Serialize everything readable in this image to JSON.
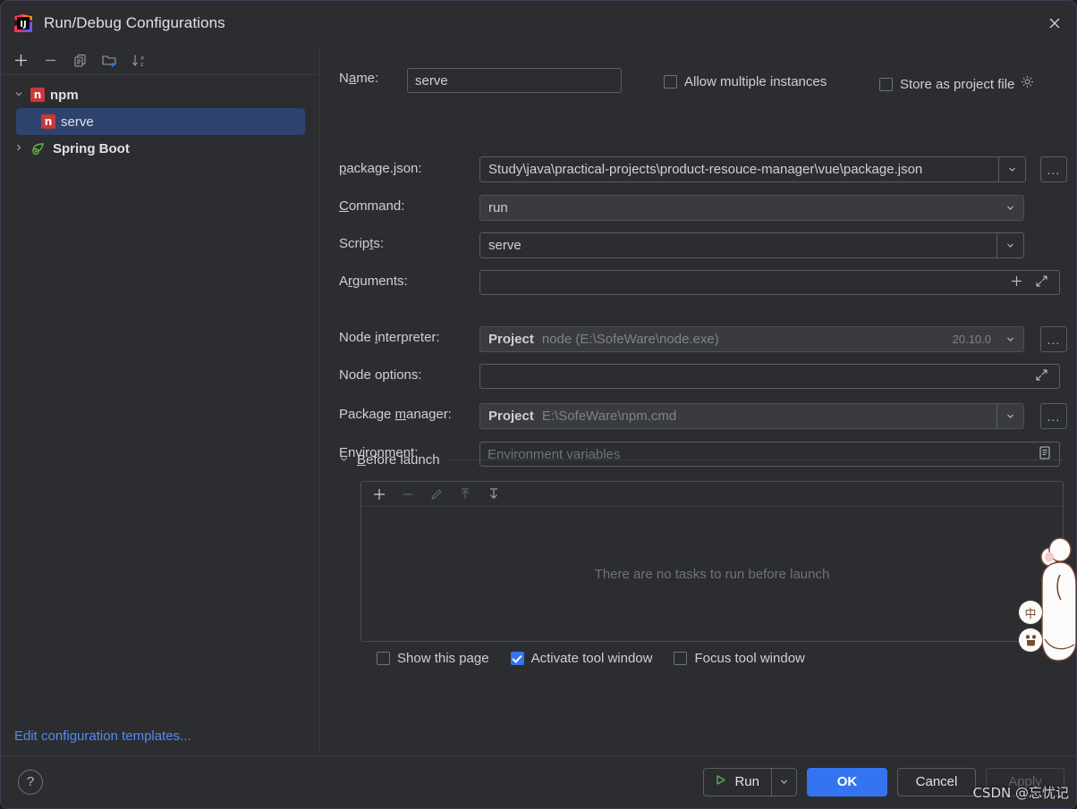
{
  "window": {
    "title": "Run/Debug Configurations",
    "app_icon": "intellij-idea-icon",
    "close_label": "✕"
  },
  "left_panel": {
    "toolbar": [
      {
        "name": "add-configuration-button",
        "label": "+"
      },
      {
        "name": "remove-configuration-button",
        "label": "−"
      },
      {
        "name": "copy-configuration-button",
        "label": "copy-icon"
      },
      {
        "name": "new-folder-button",
        "label": "new-folder-icon"
      },
      {
        "name": "sort-configurations-button",
        "label": "sort-az-icon"
      }
    ],
    "tree": [
      {
        "label": "npm",
        "icon": "npm-icon",
        "expanded": true,
        "level": 0,
        "selected": false,
        "caret": "⌄"
      },
      {
        "label": "serve",
        "icon": "npm-icon",
        "level": 1,
        "selected": true,
        "caret": ""
      },
      {
        "label": "Spring Boot",
        "icon": "spring-boot-icon",
        "expanded": false,
        "level": 0,
        "selected": false,
        "caret": "›"
      }
    ],
    "edit_templates_link": "Edit configuration templates..."
  },
  "form": {
    "name": {
      "label_pre": "N",
      "label_mnemonic": "a",
      "label_post": "me:",
      "label_full": "Name:",
      "value": "serve"
    },
    "allow_multiple_instances": {
      "label": "Allow multiple instances",
      "checked": false
    },
    "store_as_project_file": {
      "label": "Store as project file",
      "checked": false,
      "icon": "gear-icon"
    },
    "package_json": {
      "label_pre": "",
      "label_mnemonic": "p",
      "label_post": "ackage.json:",
      "label_full": "package.json:",
      "value": "Study\\java\\practical-projects\\product-resouce-manager\\vue\\package.json",
      "dropdown_icon": "chevron-down-icon",
      "browse_label": "..."
    },
    "command": {
      "label_pre": "",
      "label_mnemonic": "C",
      "label_post": "ommand:",
      "label_full": "Command:",
      "value": "run",
      "dropdown_icon": "chevron-down-icon"
    },
    "scripts": {
      "label_pre": "Scrip",
      "label_mnemonic": "t",
      "label_post": "s:",
      "label_full": "Scripts:",
      "value": "serve",
      "dropdown_icon": "chevron-down-icon"
    },
    "arguments": {
      "label_pre": "A",
      "label_mnemonic": "r",
      "label_post": "guments:",
      "label_full": "Arguments:",
      "value": "",
      "add_icon": "plus-icon",
      "expand_icon": "expand-icon"
    },
    "node_interpreter": {
      "label_pre": "Node ",
      "label_mnemonic": "i",
      "label_post": "nterpreter:",
      "label_full": "Node interpreter:",
      "scope": "Project",
      "value": "node (E:\\SofeWare\\node.exe)",
      "version": "20.10.0",
      "dropdown_icon": "chevron-down-icon",
      "browse_label": "..."
    },
    "node_options": {
      "label_full": "Node options:",
      "value": "",
      "expand_icon": "expand-icon"
    },
    "package_manager": {
      "label_pre": "Package ",
      "label_mnemonic": "m",
      "label_post": "anager:",
      "label_full": "Package manager:",
      "scope": "Project",
      "value": "E:\\SofeWare\\npm.cmd",
      "dropdown_icon": "chevron-down-icon",
      "browse_label": "..."
    },
    "environment": {
      "label_full": "Environment:",
      "value": "",
      "placeholder": "Environment variables",
      "editor_icon": "variables-list-icon"
    }
  },
  "before_launch": {
    "label_pre": "",
    "label_mnemonic": "B",
    "label_post": "efore launch",
    "label_full": "Before launch",
    "caret": "⌄",
    "toolbar": [
      {
        "name": "add-task-button",
        "label": "+",
        "enabled": true
      },
      {
        "name": "remove-task-button",
        "label": "−",
        "enabled": false
      },
      {
        "name": "edit-task-button",
        "label": "pencil-icon",
        "enabled": false
      },
      {
        "name": "move-task-up-button",
        "label": "arrow-up-icon",
        "enabled": false
      },
      {
        "name": "move-task-down-button",
        "label": "arrow-down-icon",
        "enabled": true
      }
    ],
    "empty_text": "There are no tasks to run before launch",
    "checkboxes": [
      {
        "name": "show-this-page-checkbox",
        "label": "Show this page",
        "checked": false
      },
      {
        "name": "activate-tool-window-checkbox",
        "label": "Activate tool window",
        "checked": true
      },
      {
        "name": "focus-tool-window-checkbox",
        "label": "Focus tool window",
        "checked": false
      }
    ]
  },
  "footer": {
    "help_label": "?",
    "run_label": "Run",
    "run_icon": "play-icon",
    "run_dropdown_icon": "chevron-down-icon",
    "ok_label": "OK",
    "cancel_label": "Cancel",
    "apply_label": "Apply",
    "apply_enabled": false
  },
  "decorations": {
    "watermark": "CSDN @忘忧记",
    "float_buttons": [
      {
        "name": "ime-chinese-toggle-button",
        "label": "中"
      },
      {
        "name": "ime-mascot-button",
        "label": "mascot-icon"
      }
    ],
    "mascot": "mouse-mascot-icon"
  },
  "colors": {
    "accent_blue": "#3574F0",
    "selection_blue": "#2E436E",
    "npm_red": "#CB3837",
    "link_blue": "#548AF7",
    "panel_bg": "#2B2D30"
  }
}
